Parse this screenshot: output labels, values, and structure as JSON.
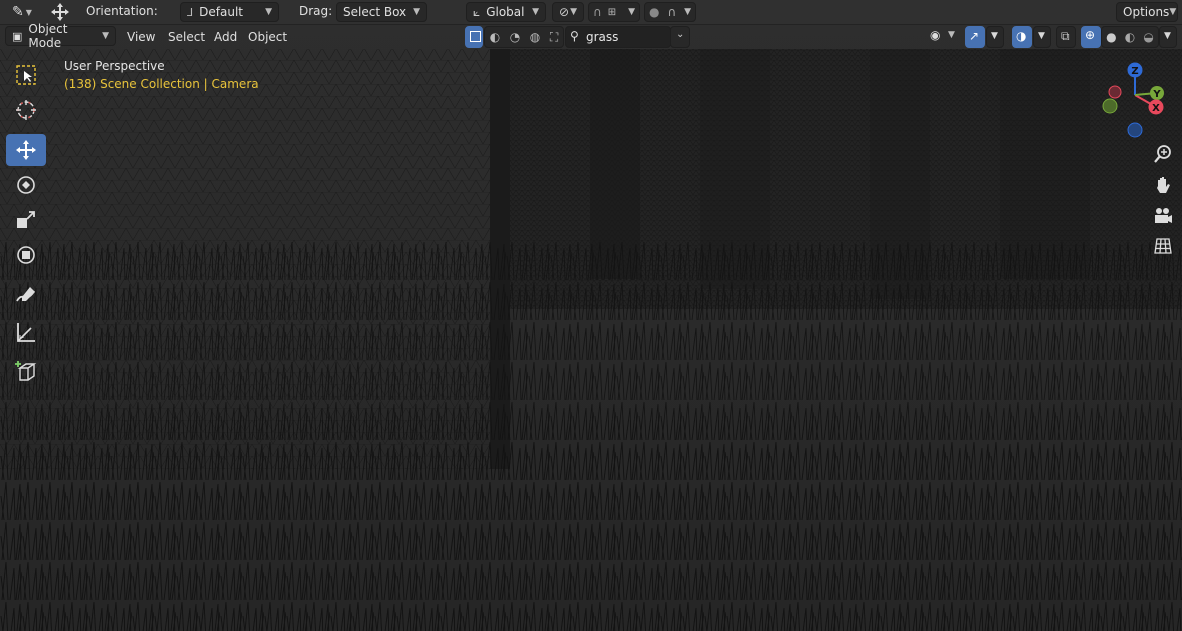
{
  "header": {
    "orientation_label": "Orientation:",
    "orientation_value": "Default",
    "drag_label": "Drag:",
    "drag_value": "Select Box",
    "transform_orientation": "Global",
    "options_label": "Options"
  },
  "viewport_header": {
    "mode": "Object Mode",
    "menus": [
      "View",
      "Select",
      "Add",
      "Object"
    ],
    "search_value": "grass"
  },
  "overlay": {
    "perspective": "User Perspective",
    "collection": "(138) Scene Collection | Camera"
  },
  "gizmo": {
    "z_label": "Z",
    "y_label": "Y",
    "x_label": "X"
  },
  "colors": {
    "accent": "#4772b3",
    "overlay_text": "#e8c33b",
    "axis_x": "#e8495c",
    "axis_y": "#78a83a",
    "axis_z": "#2e6ad6",
    "header_bg": "#303030"
  },
  "toolbar_tools": [
    "select-box-icon",
    "cursor-icon",
    "move-icon",
    "rotate-icon",
    "scale-icon",
    "transform-icon",
    "annotate-icon",
    "measure-icon",
    "add-cube-icon"
  ],
  "navigation_tools": [
    "zoom-icon",
    "pan-hand-icon",
    "camera-view-icon",
    "ortho-grid-icon"
  ]
}
